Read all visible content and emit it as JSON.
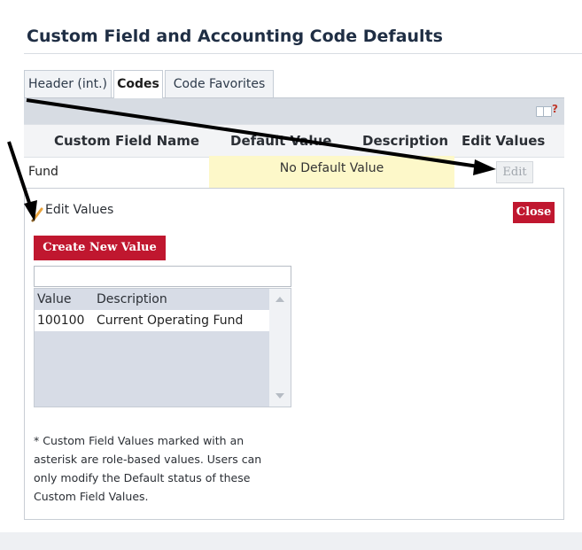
{
  "page": {
    "title": "Custom Field and Accounting Code Defaults"
  },
  "tabs": [
    {
      "label": "Header (int.)",
      "active": false
    },
    {
      "label": "Codes",
      "active": true
    },
    {
      "label": "Code Favorites",
      "active": false
    }
  ],
  "toolbar": {
    "help_icon": "help-book-icon",
    "help_mark": "?"
  },
  "table": {
    "headers": [
      "Custom Field Name",
      "Default Value",
      "Description",
      "Edit Values"
    ],
    "rows": [
      {
        "name": "Fund",
        "default_value": "No Default Value",
        "edit_label": "Edit"
      }
    ]
  },
  "edit_panel": {
    "title": "Edit Values",
    "close_label": "Close",
    "create_label": "Create New Value",
    "search_value": "",
    "list": {
      "headers": [
        "Value",
        "Description"
      ],
      "rows": [
        {
          "value": "100100",
          "description": "Current Operating Fund"
        }
      ]
    },
    "footnote": "* Custom Field Values marked with an asterisk are role-based values. Users can only modify the Default status of these Custom Field Values."
  },
  "colors": {
    "accent_red": "#c0172f",
    "default_highlight": "#fdf8c9",
    "toolbar_bg": "#d7dce3",
    "title_text": "#1f2e44"
  }
}
